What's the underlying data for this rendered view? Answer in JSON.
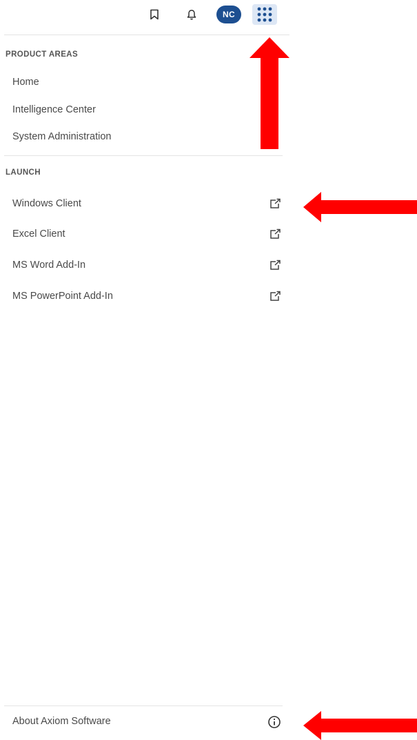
{
  "header": {
    "icons": [
      "bookmark-icon",
      "bell-icon",
      "avatar",
      "apps-grid-icon"
    ],
    "avatar_initials": "NC",
    "avatar_color": "#1d4f91",
    "apps_button_bg": "#dde7f5"
  },
  "product_areas": {
    "title": "PRODUCT AREAS",
    "items": [
      {
        "label": "Home"
      },
      {
        "label": "Intelligence Center"
      },
      {
        "label": "System Administration"
      }
    ]
  },
  "launch": {
    "title": "LAUNCH",
    "items": [
      {
        "label": "Windows Client",
        "icon": "external-link-icon"
      },
      {
        "label": "Excel Client",
        "icon": "external-link-icon"
      },
      {
        "label": "MS Word Add-In",
        "icon": "external-link-icon"
      },
      {
        "label": "MS PowerPoint Add-In",
        "icon": "external-link-icon"
      }
    ]
  },
  "footer": {
    "about_label": "About Axiom Software",
    "icon": "info-icon"
  },
  "annotations": {
    "arrow_color": "#ff0000",
    "arrows": [
      "up-arrow-to-apps-button",
      "left-arrow-to-windows-client",
      "left-arrow-to-about"
    ]
  }
}
